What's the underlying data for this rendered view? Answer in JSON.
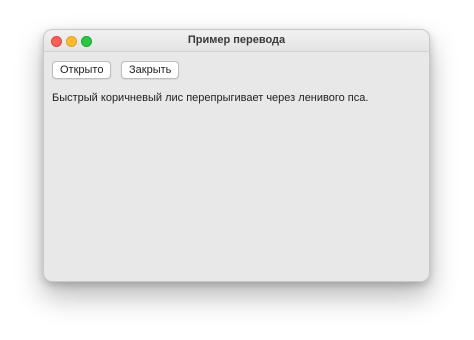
{
  "window": {
    "title": "Пример перевода"
  },
  "toolbar": {
    "open_label": "Открыто",
    "close_label": "Закрыть"
  },
  "content": {
    "text": "Быстрый коричневый лис перепрыгивает через ленивого пса."
  },
  "colors": {
    "window_bg": "#e8e8e8",
    "traffic_close": "#fe5f57",
    "traffic_minimize": "#febc2e",
    "traffic_zoom": "#28c840"
  }
}
